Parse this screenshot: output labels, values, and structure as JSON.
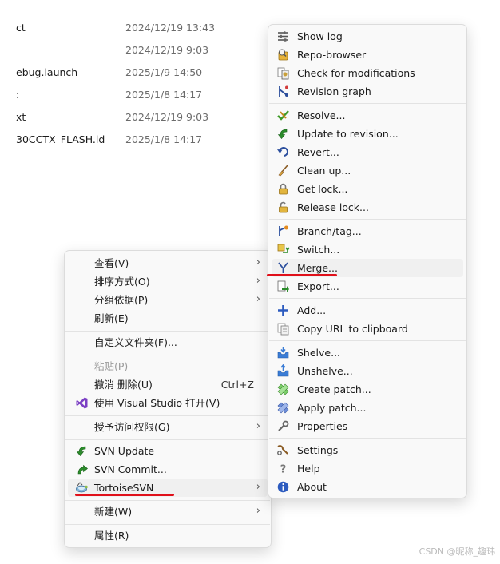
{
  "file_list": [
    {
      "name": "ct",
      "date": "2024/12/19 13:43"
    },
    {
      "name": "",
      "date": "2024/12/19 9:03"
    },
    {
      "name": "ebug.launch",
      "date": "2025/1/9 14:50"
    },
    {
      "name": ":",
      "date": "2025/1/8 14:17"
    },
    {
      "name": "xt",
      "date": "2024/12/19 9:03"
    },
    {
      "name": "30CCTX_FLASH.ld",
      "date": "2025/1/8 14:17"
    }
  ],
  "context_menu": {
    "view": "查看(V)",
    "sort": "排序方式(O)",
    "group": "分组依据(P)",
    "refresh": "刷新(E)",
    "customize": "自定义文件夹(F)...",
    "paste": "粘贴(P)",
    "undo": "撤消 删除(U)",
    "undo_shortcut": "Ctrl+Z",
    "open_vs": "使用 Visual Studio 打开(V)",
    "grant_access": "授予访问权限(G)",
    "svn_update": "SVN Update",
    "svn_commit": "SVN Commit...",
    "tortoise": "TortoiseSVN",
    "new": "新建(W)",
    "properties": "属性(R)",
    "chevron": "›"
  },
  "tortoise_menu": {
    "show_log": "Show log",
    "repo_browser": "Repo-browser",
    "check_mods": "Check for modifications",
    "rev_graph": "Revision graph",
    "resolve": "Resolve...",
    "update_rev": "Update to revision...",
    "revert": "Revert...",
    "cleanup": "Clean up...",
    "get_lock": "Get lock...",
    "release_lock": "Release lock...",
    "branch_tag": "Branch/tag...",
    "switch": "Switch...",
    "merge": "Merge...",
    "export": "Export...",
    "add": "Add...",
    "copy_url": "Copy URL to clipboard",
    "shelve": "Shelve...",
    "unshelve": "Unshelve...",
    "create_patch": "Create patch...",
    "apply_patch": "Apply patch...",
    "properties": "Properties",
    "settings": "Settings",
    "help": "Help",
    "about": "About"
  },
  "watermark": "CSDN @昵称_趣玮",
  "colors": {
    "highlight_underline": "#e0101a",
    "hover": "#f0f0f0",
    "menu_bg": "#f9f9f9"
  }
}
